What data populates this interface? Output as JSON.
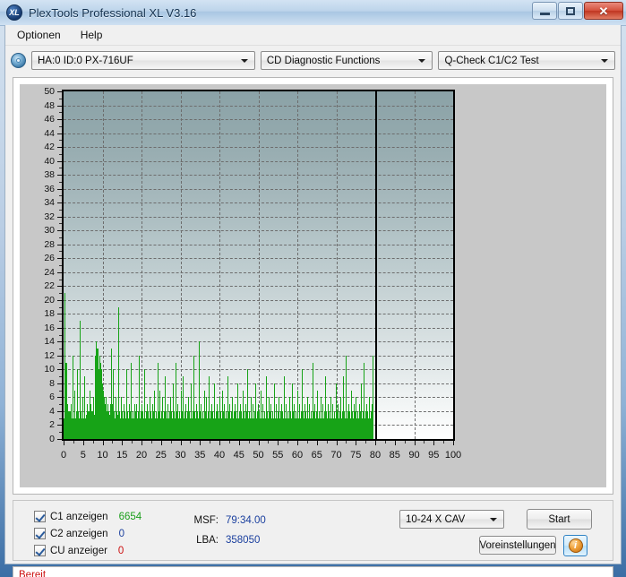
{
  "window": {
    "title": "PlexTools Professional XL V3.16",
    "icon": "disc-xl-icon",
    "buttons": {
      "minimize": "–",
      "maximize": "□",
      "close": "✕"
    }
  },
  "menubar": {
    "items": [
      {
        "label": "Optionen"
      },
      {
        "label": "Help"
      }
    ]
  },
  "toolbar": {
    "drive_icon": "optical-disc-icon",
    "device": {
      "value": "HA:0 ID:0  PX-716UF"
    },
    "function": {
      "value": "CD Diagnostic Functions"
    },
    "test": {
      "value": "Q-Check C1/C2 Test"
    }
  },
  "chart_data": {
    "type": "bar",
    "title": "",
    "xlabel": "",
    "ylabel": "",
    "xlim": [
      0,
      100
    ],
    "ylim": [
      0,
      50
    ],
    "grid": true,
    "legend_position": "bottom-left",
    "x_ticks": [
      0,
      5,
      10,
      15,
      20,
      25,
      30,
      35,
      40,
      45,
      50,
      55,
      60,
      65,
      70,
      75,
      80,
      85,
      90,
      95,
      100
    ],
    "y_ticks": [
      0,
      2,
      4,
      6,
      8,
      10,
      12,
      14,
      16,
      18,
      20,
      22,
      24,
      26,
      28,
      30,
      32,
      34,
      36,
      38,
      40,
      42,
      44,
      46,
      48,
      50
    ],
    "data_end_x": 79.6,
    "marker_x": 80,
    "series": [
      {
        "name": "C1",
        "color": "#17a317",
        "x_step": 0.2,
        "values": [
          3,
          21,
          11,
          11,
          11,
          5,
          4,
          3,
          4,
          5,
          3,
          12,
          4,
          3,
          7,
          3,
          4,
          10,
          3,
          4,
          3,
          17,
          4,
          3,
          6,
          3,
          4,
          9,
          3,
          3,
          5,
          4,
          3,
          7,
          3,
          5,
          4,
          3,
          6,
          3,
          4,
          12,
          14,
          13,
          13,
          10,
          12,
          11,
          9,
          10,
          8,
          7,
          6,
          5,
          6,
          4,
          3,
          5,
          4,
          3,
          5,
          13,
          5,
          4,
          10,
          4,
          3,
          6,
          4,
          3,
          5,
          19,
          4,
          3,
          6,
          4,
          3,
          5,
          3,
          4,
          3,
          10,
          4,
          3,
          5,
          3,
          4,
          11,
          3,
          4,
          3,
          5,
          4,
          3,
          5,
          3,
          4,
          12,
          3,
          4,
          3,
          5,
          4,
          3,
          10,
          3,
          4,
          5,
          3,
          4,
          3,
          6,
          4,
          3,
          5,
          3,
          4,
          7,
          3,
          4,
          3,
          11,
          4,
          3,
          7,
          3,
          4,
          6,
          3,
          4,
          3,
          9,
          4,
          3,
          5,
          3,
          4,
          6,
          3,
          4,
          3,
          8,
          4,
          3,
          11,
          3,
          4,
          5,
          3,
          4,
          3,
          7,
          4,
          3,
          9,
          3,
          4,
          5,
          3,
          4,
          3,
          6,
          4,
          3,
          8,
          3,
          4,
          12,
          3,
          4,
          3,
          5,
          4,
          3,
          14,
          3,
          4,
          5,
          3,
          4,
          3,
          7,
          4,
          3,
          6,
          3,
          4,
          9,
          3,
          4,
          3,
          5,
          4,
          3,
          8,
          3,
          4,
          5,
          3,
          4,
          3,
          6,
          4,
          3,
          7,
          3,
          4,
          5,
          3,
          4,
          3,
          9,
          4,
          3,
          5,
          3,
          4,
          6,
          3,
          4,
          3,
          5,
          4,
          3,
          8,
          3,
          4,
          5,
          3,
          4,
          3,
          7,
          4,
          3,
          5,
          3,
          4,
          10,
          3,
          4,
          3,
          6,
          4,
          3,
          5,
          3,
          4,
          8,
          3,
          4,
          3,
          5,
          4,
          3,
          7,
          3,
          4,
          5,
          3,
          4,
          3,
          9,
          4,
          3,
          6,
          3,
          4,
          5,
          3,
          4,
          3,
          8,
          4,
          3,
          5,
          3,
          4,
          6,
          3,
          4,
          3,
          5,
          4,
          3,
          9,
          3,
          4,
          5,
          3,
          4,
          3,
          6,
          4,
          3,
          8,
          3,
          4,
          5,
          3,
          4,
          3,
          7,
          4,
          3,
          5,
          3,
          4,
          10,
          3,
          4,
          3,
          5,
          4,
          3,
          6,
          3,
          4,
          5,
          3,
          4,
          3,
          11,
          4,
          3,
          5,
          3,
          4,
          7,
          3,
          4,
          3,
          6,
          4,
          3,
          5,
          3,
          4,
          9,
          3,
          4,
          3,
          5,
          4,
          3,
          6,
          3,
          4,
          5,
          3,
          4,
          3,
          8,
          4,
          3,
          5,
          3,
          4,
          6,
          3,
          4,
          3,
          9,
          4,
          3,
          12,
          3,
          4,
          5,
          3,
          4,
          3,
          7,
          4,
          3,
          5,
          3,
          4,
          6,
          3,
          4,
          3,
          5,
          4,
          3,
          8,
          3,
          4,
          11,
          3,
          4,
          3,
          5,
          4,
          3,
          6,
          3,
          4,
          5,
          3,
          12
        ]
      },
      {
        "name": "C2",
        "color": "#2222cc",
        "values": []
      },
      {
        "name": "CU",
        "color": "#cc1111",
        "values": []
      }
    ]
  },
  "legend": {
    "items": [
      {
        "label": "C1 anzeigen",
        "value": "6654",
        "color": "#1a9e1a",
        "checked": true
      },
      {
        "label": "C2 anzeigen",
        "value": "0",
        "color": "#1a3f9e",
        "checked": true
      },
      {
        "label": "CU anzeiger",
        "value": "0",
        "color": "#cc1111",
        "checked": true
      }
    ]
  },
  "readouts": [
    {
      "label": "MSF:",
      "value": "79:34.00"
    },
    {
      "label": "LBA:",
      "value": "358050"
    }
  ],
  "controls": {
    "speed": {
      "value": "10-24 X CAV"
    },
    "start_label": "Start",
    "presets_label": "Voreinstellungen",
    "info_label": "i"
  },
  "statusbar": {
    "text": "Bereit"
  }
}
